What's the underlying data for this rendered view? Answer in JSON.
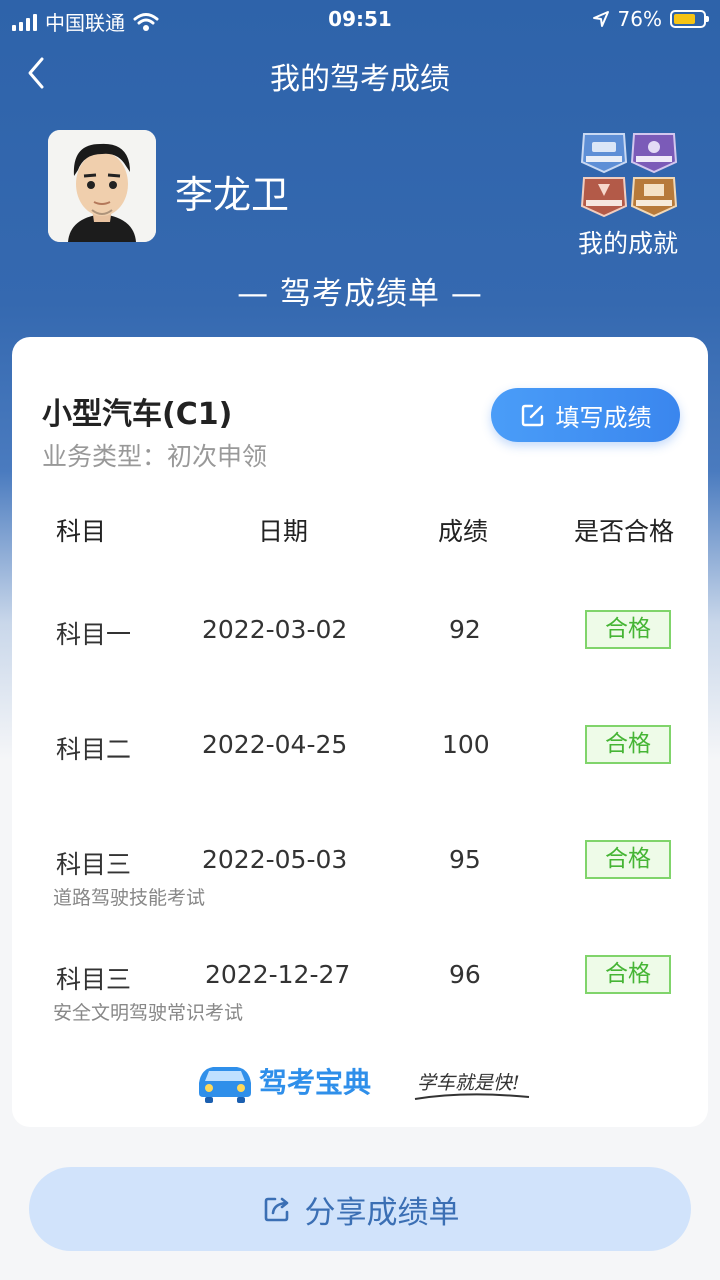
{
  "status": {
    "carrier": "中国联通",
    "time": "09:51",
    "battery": "76%",
    "battery_level": 0.76
  },
  "nav": {
    "title": "我的驾考成绩"
  },
  "user": {
    "name": "李龙卫"
  },
  "achievements": {
    "label": "我的成就"
  },
  "section_title": "— 驾考成绩单 —",
  "card": {
    "vehicle": "小型汽车(C1)",
    "biz_type": "业务类型：初次申领",
    "fill_button": "填写成绩",
    "headers": [
      "科目",
      "日期",
      "成绩",
      "是否合格"
    ],
    "rows": [
      {
        "subject": "科目一",
        "date": "2022-03-02",
        "score": "92",
        "status": "合格",
        "note": ""
      },
      {
        "subject": "科目二",
        "date": "2022-04-25",
        "score": "100",
        "status": "合格",
        "note": ""
      },
      {
        "subject": "科目三",
        "date": "2022-05-03",
        "score": "95",
        "status": "合格",
        "note": "道路驾驶技能考试"
      },
      {
        "subject": "科目三",
        "date": "2022-12-27",
        "score": "96",
        "status": "合格",
        "note": "安全文明驾驶常识考试"
      }
    ],
    "brand_name": "驾考宝典",
    "brand_slogan": "学车就是快!"
  },
  "share_button": "分享成绩单",
  "colors": {
    "header_blue": "#2e63aa",
    "button_blue": "#3a86ee",
    "pass_green": "#46b535",
    "share_bg": "#d1e3fb"
  }
}
